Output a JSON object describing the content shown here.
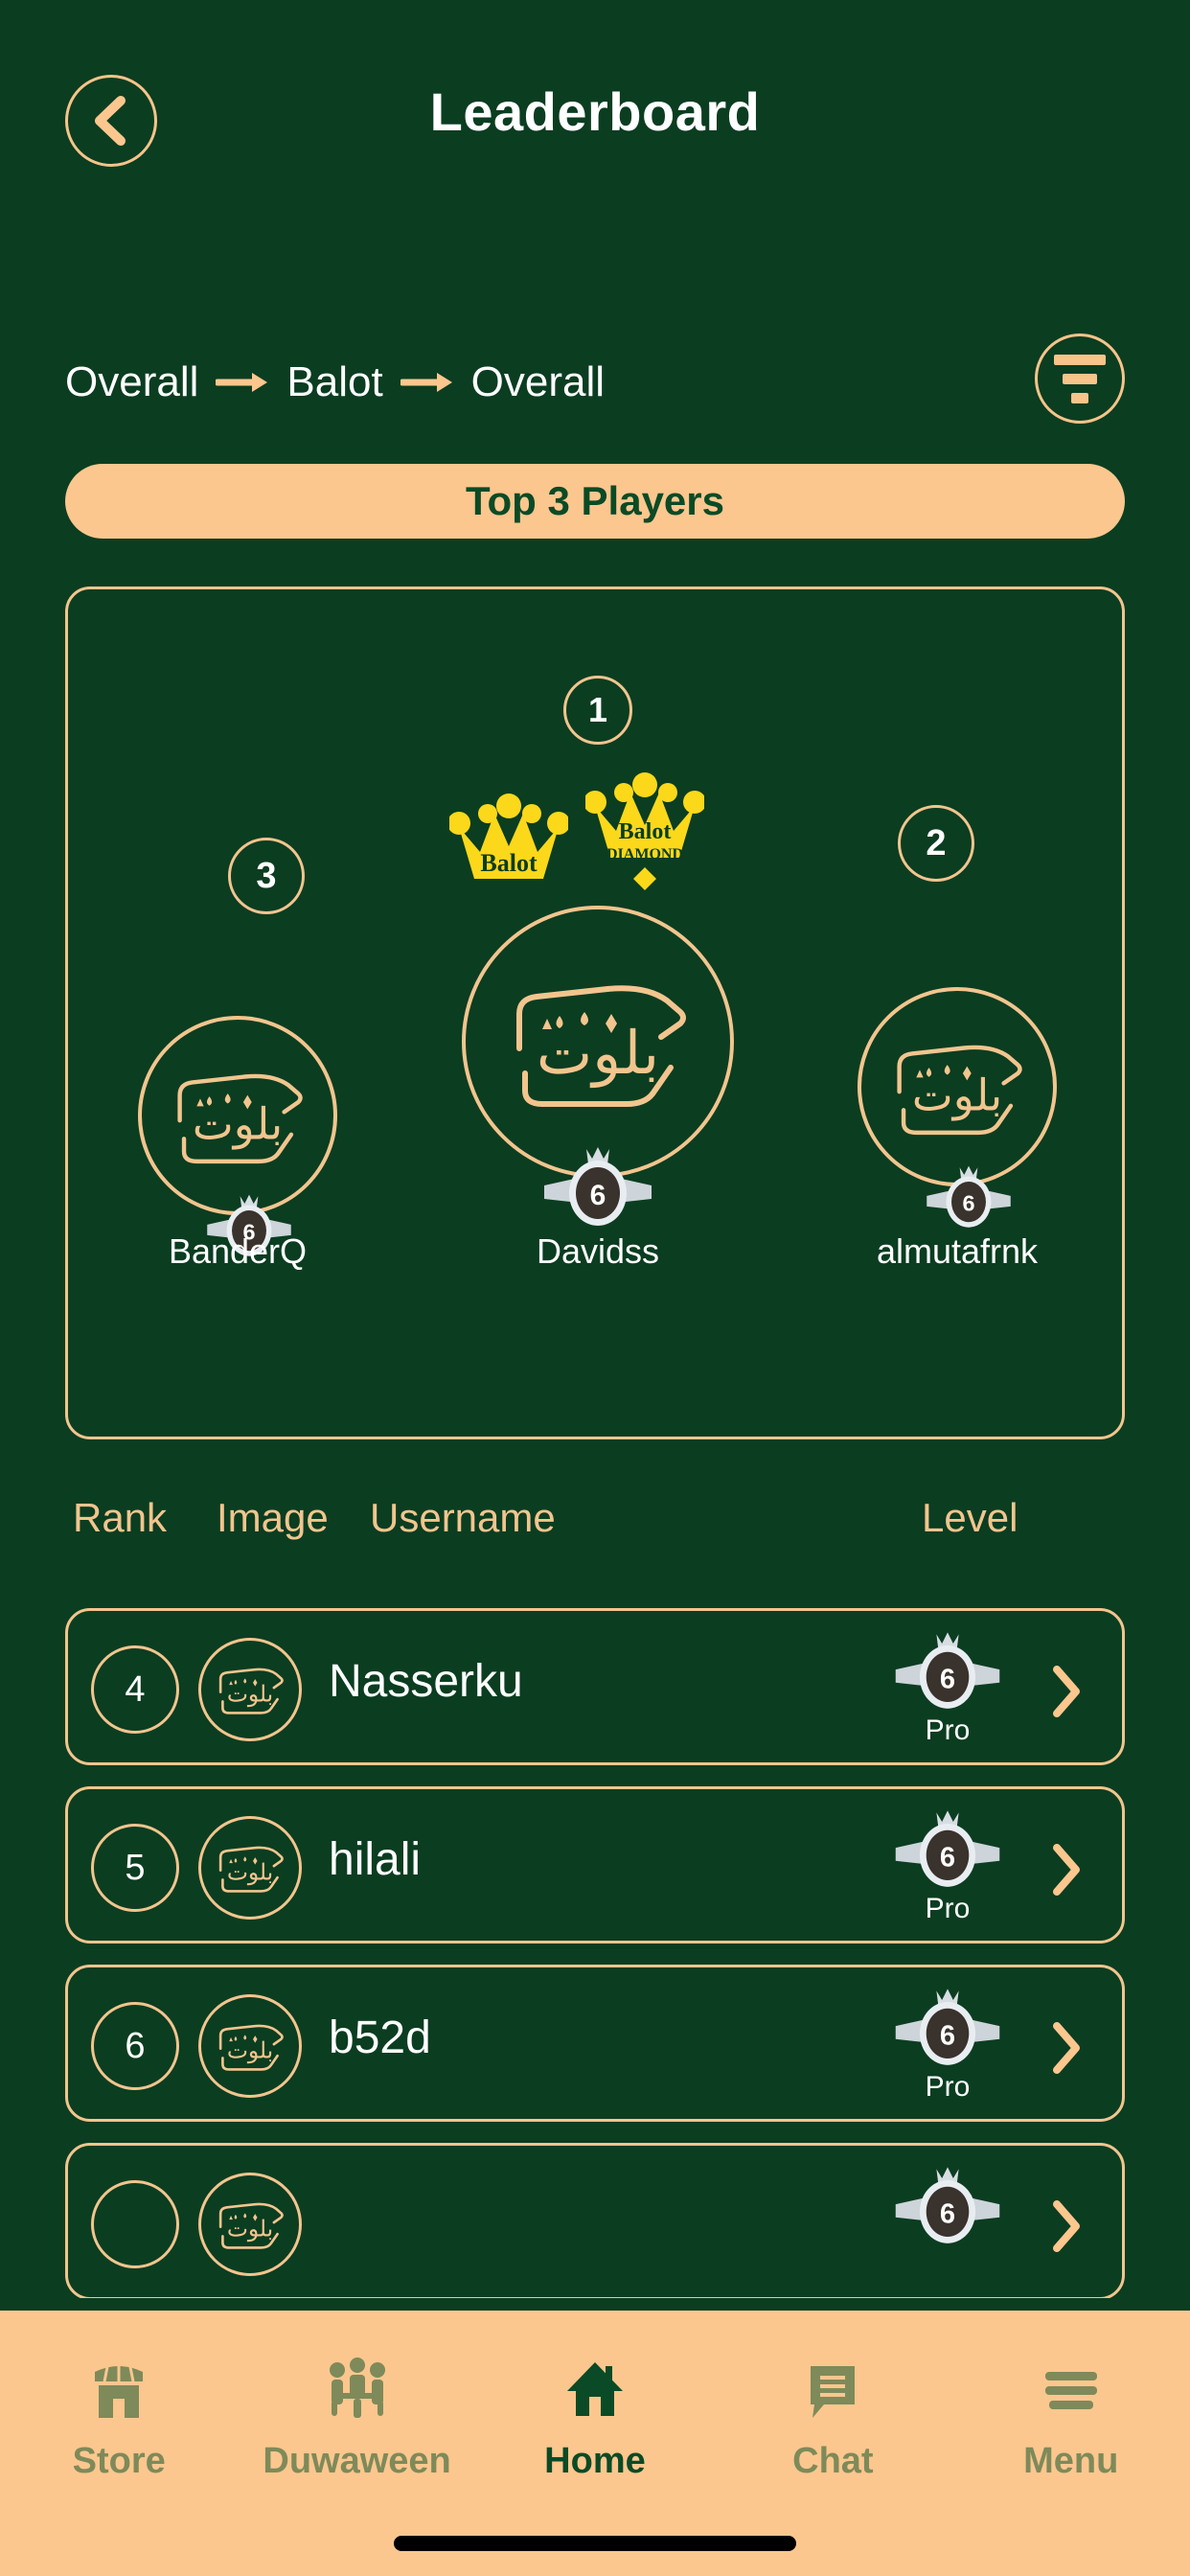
{
  "theme": {
    "bg_green": "#0b3d21",
    "accent_peach": "#fbc78e",
    "border_gold": "#f2c58e",
    "crown_gold": "#fbd81a",
    "text_white": "#ffffff",
    "nav_inactive": "#7e8a5a",
    "nav_active": "#0b4a26"
  },
  "header": {
    "title": "Leaderboard",
    "back_icon": "chevron-left-icon"
  },
  "breadcrumb": {
    "items": [
      "Overall",
      "Balot",
      "Overall"
    ],
    "separator": "arrow-right-icon",
    "filter_icon": "filter-icon"
  },
  "top3_banner": {
    "label": "Top 3 Players"
  },
  "podium": {
    "crowns": [
      {
        "icon": "crown-icon",
        "label": "Balot",
        "sublabel": ""
      },
      {
        "icon": "crown-icon",
        "label": "Balot",
        "sublabel": "DIAMOND"
      }
    ],
    "players": [
      {
        "rank": "1",
        "username": "Davidss",
        "level": "6",
        "avatar_icon": "balot-logo-avatar",
        "badge_icon": "level-badge-icon"
      },
      {
        "rank": "2",
        "username": "almutafrnk",
        "level": "6",
        "avatar_icon": "balot-logo-avatar",
        "badge_icon": "level-badge-icon"
      },
      {
        "rank": "3",
        "username": "BanderQ",
        "level": "6",
        "avatar_icon": "balot-logo-avatar",
        "badge_icon": "level-badge-icon"
      }
    ]
  },
  "list": {
    "headers": {
      "rank": "Rank",
      "image": "Image",
      "username": "Username",
      "level": "Level"
    },
    "rows": [
      {
        "rank": "4",
        "username": "Nasserku",
        "level": "6",
        "level_label": "Pro",
        "avatar_icon": "balot-logo-avatar",
        "badge_icon": "level-badge-icon",
        "chevron_icon": "chevron-right-icon"
      },
      {
        "rank": "5",
        "username": "hilali",
        "level": "6",
        "level_label": "Pro",
        "avatar_icon": "balot-logo-avatar",
        "badge_icon": "level-badge-icon",
        "chevron_icon": "chevron-right-icon"
      },
      {
        "rank": "6",
        "username": "b52d",
        "level": "6",
        "level_label": "Pro",
        "avatar_icon": "balot-logo-avatar",
        "badge_icon": "level-badge-icon",
        "chevron_icon": "chevron-right-icon"
      },
      {
        "rank": "",
        "username": "",
        "level": "",
        "level_label": "",
        "avatar_icon": "balot-logo-avatar",
        "badge_icon": "level-badge-icon",
        "chevron_icon": "chevron-right-icon"
      }
    ]
  },
  "bottom_nav": {
    "items": [
      {
        "label": "Store",
        "icon": "store-icon",
        "active": false
      },
      {
        "label": "Duwaween",
        "icon": "people-table-icon",
        "active": false
      },
      {
        "label": "Home",
        "icon": "home-icon",
        "active": true
      },
      {
        "label": "Chat",
        "icon": "chat-bubble-icon",
        "active": false
      },
      {
        "label": "Menu",
        "icon": "hamburger-menu-icon",
        "active": false
      }
    ]
  }
}
